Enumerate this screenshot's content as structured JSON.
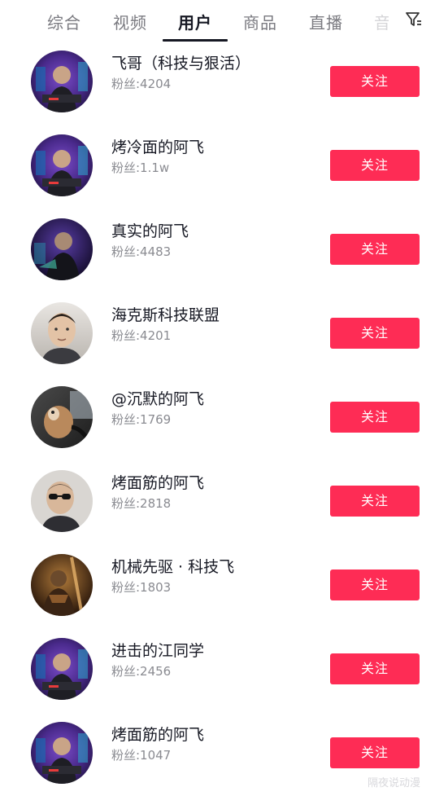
{
  "tabs": [
    {
      "label": "综合",
      "active": false
    },
    {
      "label": "视频",
      "active": false
    },
    {
      "label": "用户",
      "active": true
    },
    {
      "label": "商品",
      "active": false
    },
    {
      "label": "直播",
      "active": false
    },
    {
      "label": "音",
      "active": false
    }
  ],
  "filter_icon": "filter-icon",
  "accent_color": "#fe2c55",
  "users": [
    {
      "name": "飞哥（科技与狠活）",
      "fans": "粉丝:4204",
      "button": "关注",
      "avatar": "avatar-purple-man"
    },
    {
      "name": "烤冷面的阿飞",
      "fans": "粉丝:1.1w",
      "button": "关注",
      "avatar": "avatar-purple-man"
    },
    {
      "name": "真实的阿飞",
      "fans": "粉丝:4483",
      "button": "关注",
      "avatar": "avatar-purple-man-dark"
    },
    {
      "name": "海克斯科技联盟",
      "fans": "粉丝:4201",
      "button": "关注",
      "avatar": "avatar-face-photo"
    },
    {
      "name": "@沉默的阿飞",
      "fans": "粉丝:1769",
      "button": "关注",
      "avatar": "avatar-car-dog"
    },
    {
      "name": "烤面筋的阿飞",
      "fans": "粉丝:2818",
      "button": "关注",
      "avatar": "avatar-sunglasses-man"
    },
    {
      "name": "机械先驱 · 科技飞",
      "fans": "粉丝:1803",
      "button": "关注",
      "avatar": "avatar-dark-warrior"
    },
    {
      "name": "进击的江同学",
      "fans": "粉丝:2456",
      "button": "关注",
      "avatar": "avatar-purple-man"
    },
    {
      "name": "烤面筋的阿飞",
      "fans": "粉丝:1047",
      "button": "关注",
      "avatar": "avatar-purple-man"
    }
  ],
  "watermark": "隔夜说动漫"
}
